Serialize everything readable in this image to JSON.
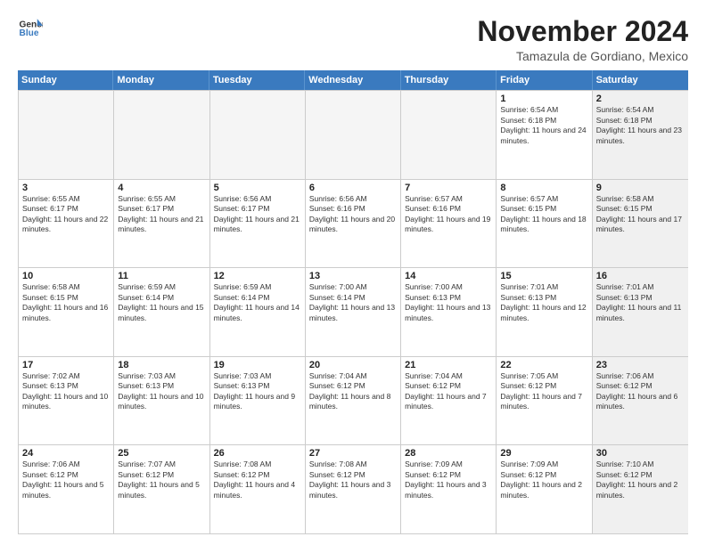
{
  "header": {
    "logo_line1": "General",
    "logo_line2": "Blue",
    "month": "November 2024",
    "location": "Tamazula de Gordiano, Mexico"
  },
  "weekdays": [
    "Sunday",
    "Monday",
    "Tuesday",
    "Wednesday",
    "Thursday",
    "Friday",
    "Saturday"
  ],
  "rows": [
    [
      {
        "day": "",
        "text": "",
        "empty": true
      },
      {
        "day": "",
        "text": "",
        "empty": true
      },
      {
        "day": "",
        "text": "",
        "empty": true
      },
      {
        "day": "",
        "text": "",
        "empty": true
      },
      {
        "day": "",
        "text": "",
        "empty": true
      },
      {
        "day": "1",
        "text": "Sunrise: 6:54 AM\nSunset: 6:18 PM\nDaylight: 11 hours and 24 minutes."
      },
      {
        "day": "2",
        "text": "Sunrise: 6:54 AM\nSunset: 6:18 PM\nDaylight: 11 hours and 23 minutes.",
        "shaded": true
      }
    ],
    [
      {
        "day": "3",
        "text": "Sunrise: 6:55 AM\nSunset: 6:17 PM\nDaylight: 11 hours and 22 minutes."
      },
      {
        "day": "4",
        "text": "Sunrise: 6:55 AM\nSunset: 6:17 PM\nDaylight: 11 hours and 21 minutes."
      },
      {
        "day": "5",
        "text": "Sunrise: 6:56 AM\nSunset: 6:17 PM\nDaylight: 11 hours and 21 minutes."
      },
      {
        "day": "6",
        "text": "Sunrise: 6:56 AM\nSunset: 6:16 PM\nDaylight: 11 hours and 20 minutes."
      },
      {
        "day": "7",
        "text": "Sunrise: 6:57 AM\nSunset: 6:16 PM\nDaylight: 11 hours and 19 minutes."
      },
      {
        "day": "8",
        "text": "Sunrise: 6:57 AM\nSunset: 6:15 PM\nDaylight: 11 hours and 18 minutes."
      },
      {
        "day": "9",
        "text": "Sunrise: 6:58 AM\nSunset: 6:15 PM\nDaylight: 11 hours and 17 minutes.",
        "shaded": true
      }
    ],
    [
      {
        "day": "10",
        "text": "Sunrise: 6:58 AM\nSunset: 6:15 PM\nDaylight: 11 hours and 16 minutes."
      },
      {
        "day": "11",
        "text": "Sunrise: 6:59 AM\nSunset: 6:14 PM\nDaylight: 11 hours and 15 minutes."
      },
      {
        "day": "12",
        "text": "Sunrise: 6:59 AM\nSunset: 6:14 PM\nDaylight: 11 hours and 14 minutes."
      },
      {
        "day": "13",
        "text": "Sunrise: 7:00 AM\nSunset: 6:14 PM\nDaylight: 11 hours and 13 minutes."
      },
      {
        "day": "14",
        "text": "Sunrise: 7:00 AM\nSunset: 6:13 PM\nDaylight: 11 hours and 13 minutes."
      },
      {
        "day": "15",
        "text": "Sunrise: 7:01 AM\nSunset: 6:13 PM\nDaylight: 11 hours and 12 minutes."
      },
      {
        "day": "16",
        "text": "Sunrise: 7:01 AM\nSunset: 6:13 PM\nDaylight: 11 hours and 11 minutes.",
        "shaded": true
      }
    ],
    [
      {
        "day": "17",
        "text": "Sunrise: 7:02 AM\nSunset: 6:13 PM\nDaylight: 11 hours and 10 minutes."
      },
      {
        "day": "18",
        "text": "Sunrise: 7:03 AM\nSunset: 6:13 PM\nDaylight: 11 hours and 10 minutes."
      },
      {
        "day": "19",
        "text": "Sunrise: 7:03 AM\nSunset: 6:13 PM\nDaylight: 11 hours and 9 minutes."
      },
      {
        "day": "20",
        "text": "Sunrise: 7:04 AM\nSunset: 6:12 PM\nDaylight: 11 hours and 8 minutes."
      },
      {
        "day": "21",
        "text": "Sunrise: 7:04 AM\nSunset: 6:12 PM\nDaylight: 11 hours and 7 minutes."
      },
      {
        "day": "22",
        "text": "Sunrise: 7:05 AM\nSunset: 6:12 PM\nDaylight: 11 hours and 7 minutes."
      },
      {
        "day": "23",
        "text": "Sunrise: 7:06 AM\nSunset: 6:12 PM\nDaylight: 11 hours and 6 minutes.",
        "shaded": true
      }
    ],
    [
      {
        "day": "24",
        "text": "Sunrise: 7:06 AM\nSunset: 6:12 PM\nDaylight: 11 hours and 5 minutes."
      },
      {
        "day": "25",
        "text": "Sunrise: 7:07 AM\nSunset: 6:12 PM\nDaylight: 11 hours and 5 minutes."
      },
      {
        "day": "26",
        "text": "Sunrise: 7:08 AM\nSunset: 6:12 PM\nDaylight: 11 hours and 4 minutes."
      },
      {
        "day": "27",
        "text": "Sunrise: 7:08 AM\nSunset: 6:12 PM\nDaylight: 11 hours and 3 minutes."
      },
      {
        "day": "28",
        "text": "Sunrise: 7:09 AM\nSunset: 6:12 PM\nDaylight: 11 hours and 3 minutes."
      },
      {
        "day": "29",
        "text": "Sunrise: 7:09 AM\nSunset: 6:12 PM\nDaylight: 11 hours and 2 minutes."
      },
      {
        "day": "30",
        "text": "Sunrise: 7:10 AM\nSunset: 6:12 PM\nDaylight: 11 hours and 2 minutes.",
        "shaded": true
      }
    ]
  ]
}
